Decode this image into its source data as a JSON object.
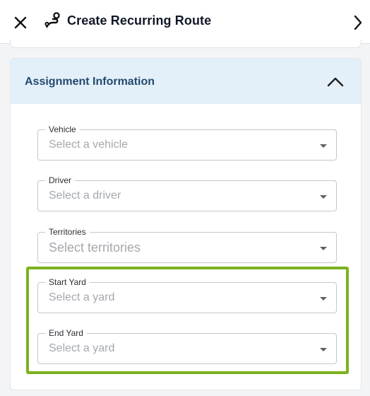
{
  "header": {
    "title": "Create Recurring Route",
    "close_icon": "close-icon",
    "route_icon": "route-icon",
    "next_icon": "chevron-right-icon"
  },
  "section": {
    "title": "Assignment Information",
    "expanded": true,
    "collapse_icon": "chevron-up-icon",
    "fields": [
      {
        "label": "Vehicle",
        "placeholder": "Select a vehicle"
      },
      {
        "label": "Driver",
        "placeholder": "Select a driver"
      },
      {
        "label": "Territories",
        "placeholder": "Select territories"
      },
      {
        "label": "Start Yard",
        "placeholder": "Select a yard"
      },
      {
        "label": "End Yard",
        "placeholder": "Select a yard"
      }
    ]
  },
  "colors": {
    "header_bg": "#ffffff",
    "section_header_bg": "#e4f0f9",
    "section_title": "#234a6f",
    "highlight_border": "#7cb21f",
    "placeholder": "#a4a9ae"
  }
}
